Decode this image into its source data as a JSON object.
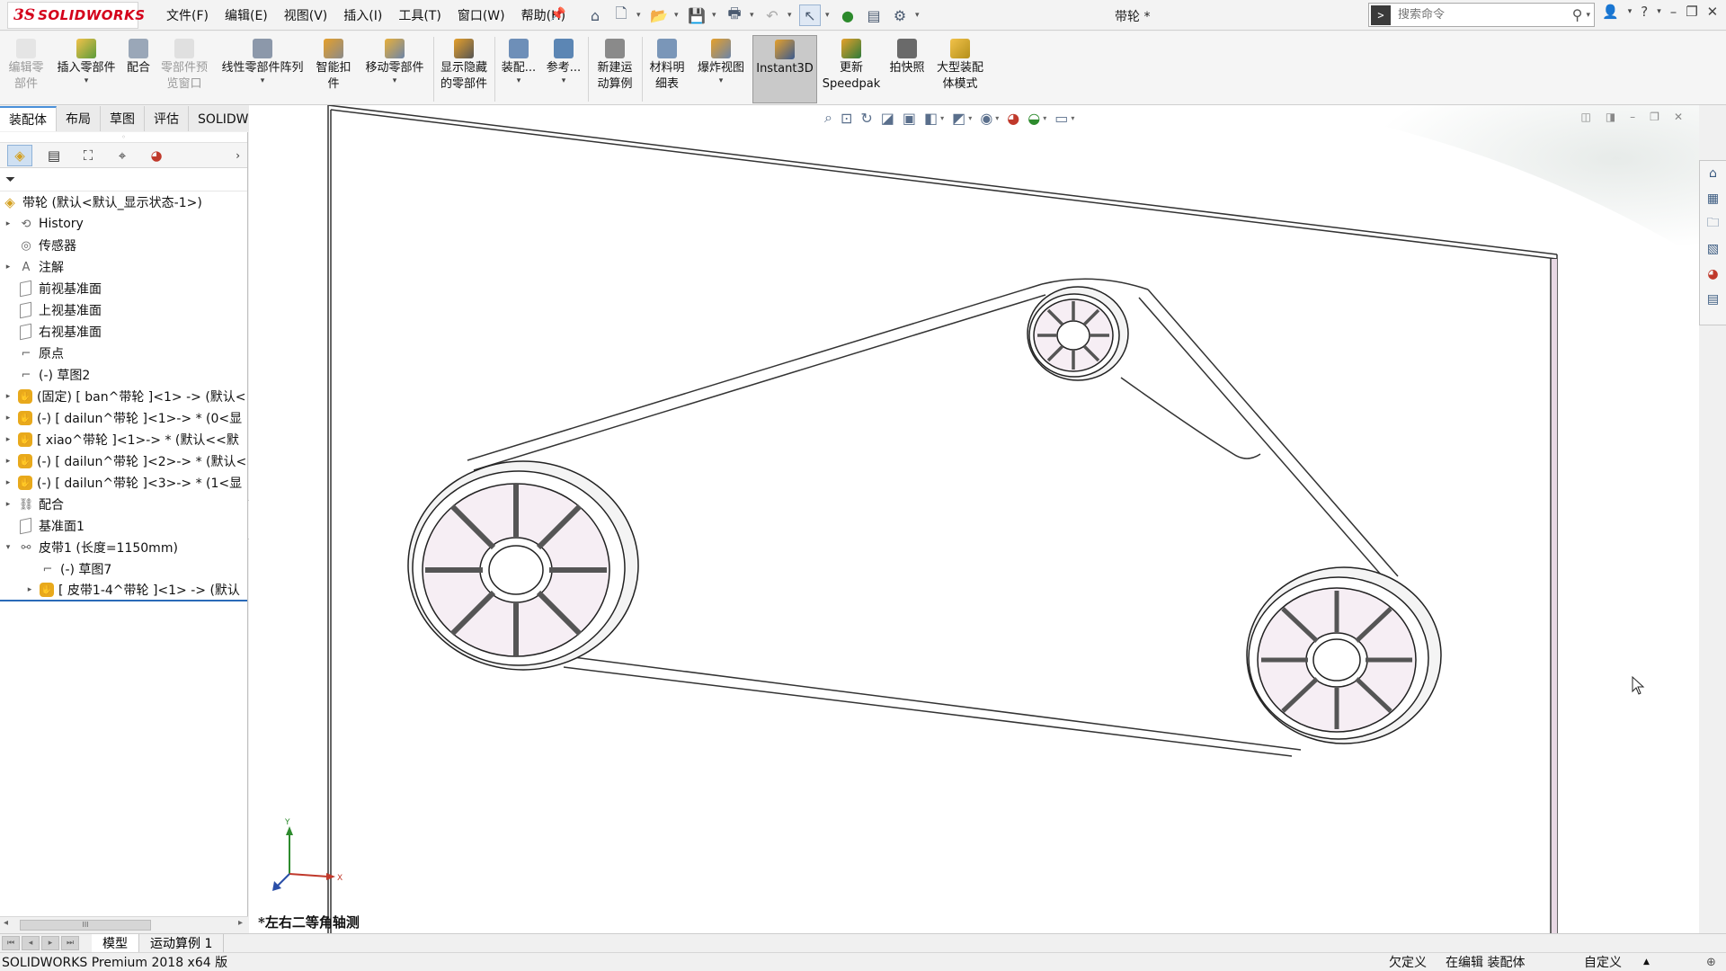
{
  "app": {
    "logo_ds": "3S",
    "logo_text": "SOLIDWORKS",
    "document_title": "带轮 *"
  },
  "menu": [
    "文件(F)",
    "编辑(E)",
    "视图(V)",
    "插入(I)",
    "工具(T)",
    "窗口(W)",
    "帮助(H)"
  ],
  "search": {
    "placeholder": "搜索命令"
  },
  "ribbon": {
    "buttons": [
      {
        "label": "编辑零\n部件",
        "icon": "edit-component-icon",
        "disabled": true
      },
      {
        "label": "插入零部件",
        "icon": "insert-component-icon",
        "disabled": false
      },
      {
        "label": "配合",
        "icon": "mate-icon",
        "disabled": false
      },
      {
        "label": "零部件预\n览窗口",
        "icon": "component-preview-icon",
        "disabled": true
      },
      {
        "label": "线性零部件阵列",
        "icon": "linear-pattern-icon",
        "disabled": false
      },
      {
        "label": "智能扣\n件",
        "icon": "smart-fasteners-icon",
        "disabled": false
      },
      {
        "label": "移动零部件",
        "icon": "move-component-icon",
        "disabled": false
      },
      {
        "label": "显示隐藏\n的零部件",
        "icon": "show-hidden-icon",
        "disabled": false
      },
      {
        "label": "装配...",
        "icon": "assembly-features-icon",
        "disabled": false
      },
      {
        "label": "参考...",
        "icon": "reference-geometry-icon",
        "disabled": false
      },
      {
        "label": "新建运\n动算例",
        "icon": "new-motion-study-icon",
        "disabled": false
      },
      {
        "label": "材料明\n细表",
        "icon": "bom-icon",
        "disabled": false
      },
      {
        "label": "爆炸视图",
        "icon": "exploded-view-icon",
        "disabled": false
      },
      {
        "label": "Instant3D",
        "icon": "instant3d-icon",
        "disabled": false
      },
      {
        "label": "更新\nSpeedpak",
        "icon": "speedpak-icon",
        "disabled": false
      },
      {
        "label": "拍快照",
        "icon": "snapshot-icon",
        "disabled": false
      },
      {
        "label": "大型装配\n体模式",
        "icon": "large-assembly-icon",
        "disabled": false
      }
    ]
  },
  "tabs": [
    "装配体",
    "布局",
    "草图",
    "评估",
    "SOLIDWORKS 插件"
  ],
  "feature_tree": {
    "root": "带轮  (默认<默认_显示状态-1>)",
    "items": [
      {
        "label": "History",
        "icon": "history-icon",
        "indent": 0,
        "expand": "▸"
      },
      {
        "label": "传感器",
        "icon": "sensor-icon",
        "indent": 0,
        "expand": ""
      },
      {
        "label": "注解",
        "icon": "annotation-icon",
        "indent": 0,
        "expand": "▸"
      },
      {
        "label": "前视基准面",
        "icon": "plane-icon",
        "indent": 0,
        "expand": ""
      },
      {
        "label": "上视基准面",
        "icon": "plane-icon",
        "indent": 0,
        "expand": ""
      },
      {
        "label": "右视基准面",
        "icon": "plane-icon",
        "indent": 0,
        "expand": ""
      },
      {
        "label": "原点",
        "icon": "origin-icon",
        "indent": 0,
        "expand": ""
      },
      {
        "label": "(-) 草图2",
        "icon": "sketch-icon",
        "indent": 0,
        "expand": ""
      },
      {
        "label": "(固定) [ ban^带轮 ]<1> -> (默认<",
        "icon": "part-icon",
        "indent": 0,
        "expand": "▸"
      },
      {
        "label": "(-) [ dailun^带轮 ]<1>-> * (0<显",
        "icon": "part-icon",
        "indent": 0,
        "expand": "▸"
      },
      {
        "label": "[ xiao^带轮 ]<1>-> * (默认<<默",
        "icon": "part-icon",
        "indent": 0,
        "expand": "▸"
      },
      {
        "label": "(-) [ dailun^带轮 ]<2>-> * (默认<",
        "icon": "part-icon",
        "indent": 0,
        "expand": "▸"
      },
      {
        "label": "(-) [ dailun^带轮 ]<3>-> * (1<显",
        "icon": "part-icon",
        "indent": 0,
        "expand": "▸"
      },
      {
        "label": "配合",
        "icon": "mates-icon",
        "indent": 0,
        "expand": "▸"
      },
      {
        "label": "基准面1",
        "icon": "plane-icon",
        "indent": 0,
        "expand": ""
      },
      {
        "label": "皮带1 (长度=1150mm)",
        "icon": "belt-icon",
        "indent": 0,
        "expand": "▾"
      },
      {
        "label": "(-) 草图7",
        "icon": "sketch-icon",
        "indent": 1,
        "expand": ""
      },
      {
        "label": "[ 皮带1-4^带轮 ]<1> -> (默认",
        "icon": "part-icon",
        "indent": 1,
        "expand": "▸"
      }
    ]
  },
  "viewport": {
    "view_label": "*左右二等角轴测",
    "triad": {
      "x": "X",
      "y": "Y"
    }
  },
  "bottom_tabs": [
    "模型",
    "运动算例 1"
  ],
  "status": {
    "app_version": "SOLIDWORKS Premium 2018 x64 版",
    "definition": "欠定义",
    "mode": "在编辑 装配体",
    "units": "自定义",
    "caret": "▲"
  }
}
